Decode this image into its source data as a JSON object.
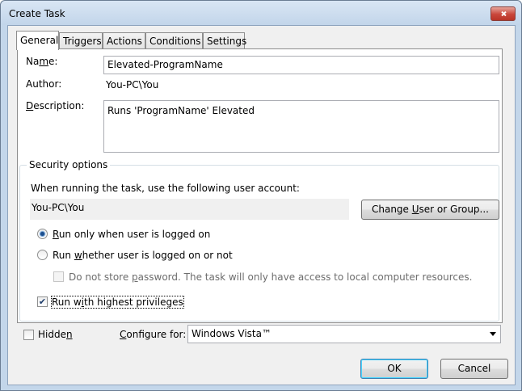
{
  "window": {
    "title": "Create Task"
  },
  "tabs": [
    {
      "label": "General",
      "active": true
    },
    {
      "label": "Triggers",
      "active": false
    },
    {
      "label": "Actions",
      "active": false
    },
    {
      "label": "Conditions",
      "active": false
    },
    {
      "label": "Settings",
      "active": false
    }
  ],
  "general": {
    "name_label_pre": "Na",
    "name_label_mn": "m",
    "name_label_post": "e:",
    "name_value": "Elevated-ProgramName",
    "author_label": "Author:",
    "author_value": "You-PC\\You",
    "description_label_mn": "D",
    "description_label_post": "escription:",
    "description_value": "Runs 'ProgramName' Elevated"
  },
  "security": {
    "group_title": "Security options",
    "account_prompt": "When running the task, use the following user account:",
    "user_account": "You-PC\\You",
    "change_button_pre": "Change ",
    "change_button_mn": "U",
    "change_button_post": "ser or Group...",
    "radio_logged_on_mn": "R",
    "radio_logged_on_post": "un only when user is logged on",
    "radio_logged_on_selected": true,
    "radio_whether_pre": "Run ",
    "radio_whether_mn": "w",
    "radio_whether_post": "hether user is logged on or not",
    "radio_whether_selected": false,
    "no_store_pre": "Do not store ",
    "no_store_mn": "p",
    "no_store_post": "assword.  The task will only have access to local computer resources.",
    "no_store_checked": false,
    "highest_pre": "Run w",
    "highest_mn": "i",
    "highest_post": "th highest privileges",
    "highest_checked": true
  },
  "footer": {
    "hidden_pre": "Hidde",
    "hidden_mn": "n",
    "hidden_checked": false,
    "configure_mn": "C",
    "configure_post": "onfigure for:",
    "configure_value": "Windows Vista™",
    "ok_label": "OK",
    "cancel_label": "Cancel"
  },
  "colors": {
    "title_bar": "#c2d5ea",
    "close_button": "#c9463a",
    "radio_dot": "#1d4f8e",
    "default_button_border": "#3c7fb1"
  },
  "icons": {
    "close": "close-icon",
    "dropdown": "chevron-down-icon",
    "check": "checkmark-icon"
  }
}
